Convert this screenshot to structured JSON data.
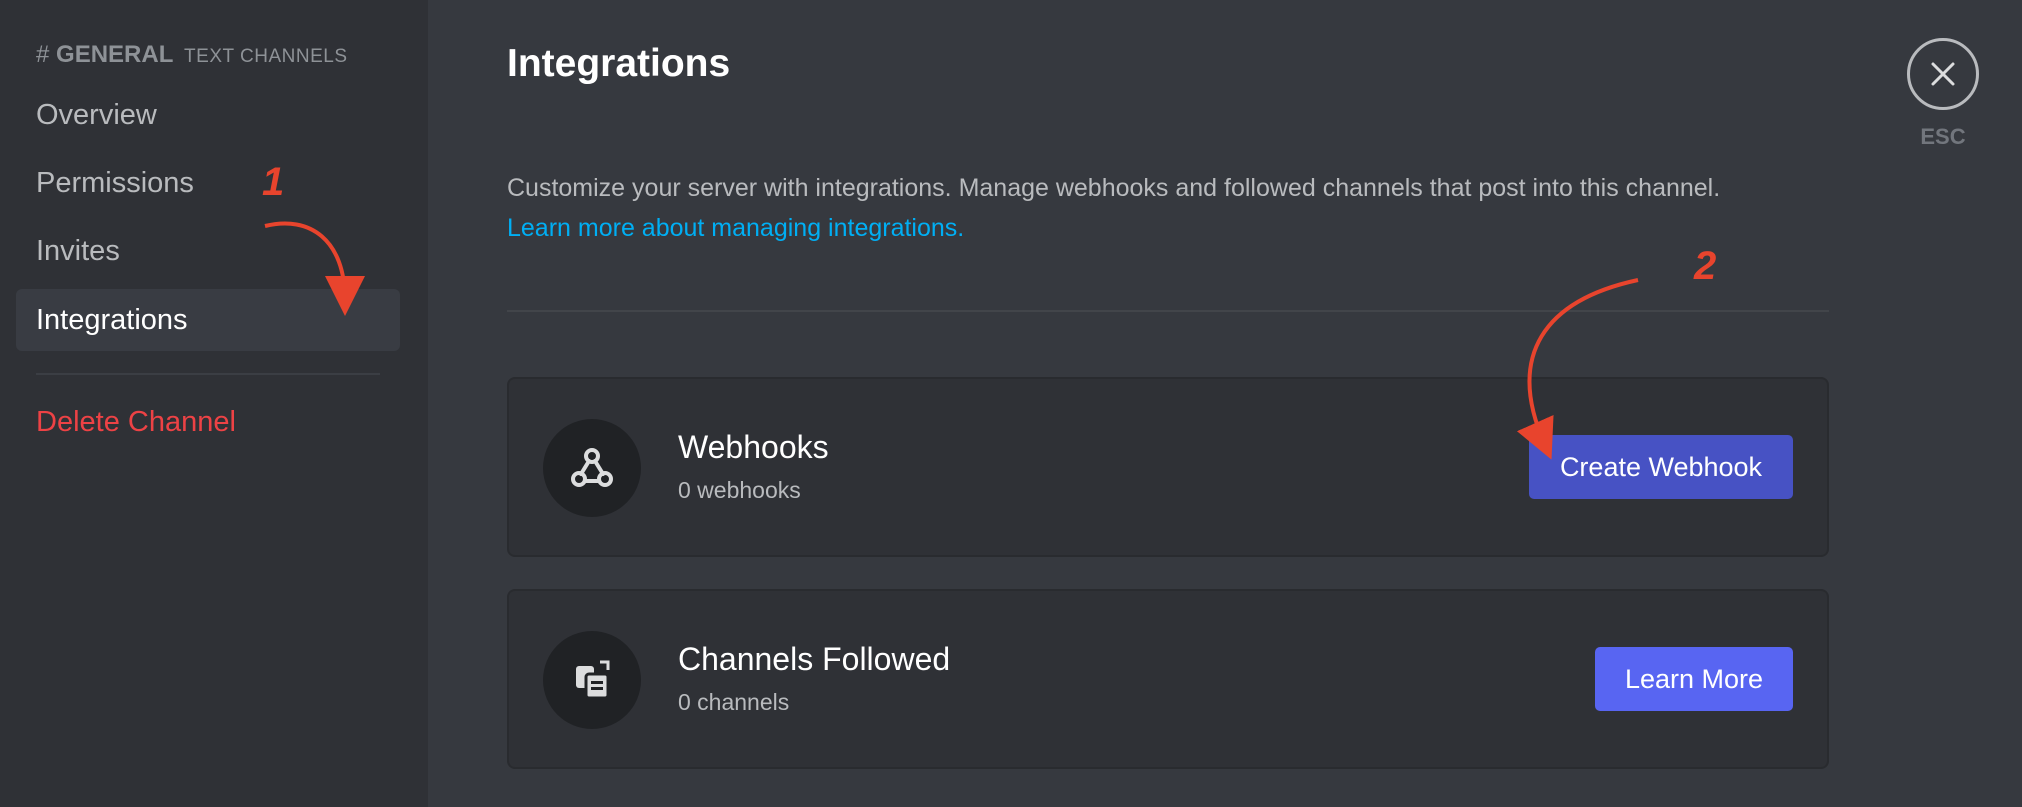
{
  "sidebar": {
    "header": {
      "hash": "#",
      "channel": "GENERAL",
      "category": "TEXT CHANNELS"
    },
    "items": [
      {
        "label": "Overview"
      },
      {
        "label": "Permissions"
      },
      {
        "label": "Invites"
      },
      {
        "label": "Integrations",
        "selected": true
      },
      {
        "label": "Delete Channel",
        "danger": true
      }
    ]
  },
  "main": {
    "title": "Integrations",
    "description": "Customize your server with integrations. Manage webhooks and followed channels that post into this channel.",
    "link": "Learn more about managing integrations.",
    "cards": [
      {
        "icon": "webhook-icon",
        "title": "Webhooks",
        "subtitle": "0 webhooks",
        "button": "Create Webhook"
      },
      {
        "icon": "channels-followed-icon",
        "title": "Channels Followed",
        "subtitle": "0 channels",
        "button": "Learn More"
      }
    ]
  },
  "close": {
    "icon": "close-icon",
    "label": "ESC"
  },
  "annotations": {
    "step1": "1",
    "step2": "2"
  },
  "colors": {
    "sidebar_bg": "#2f3136",
    "main_bg": "#36393f",
    "link": "#00aff4",
    "danger": "#ed4245",
    "primary_button": "#5865f2",
    "annotation": "#e8442d"
  }
}
